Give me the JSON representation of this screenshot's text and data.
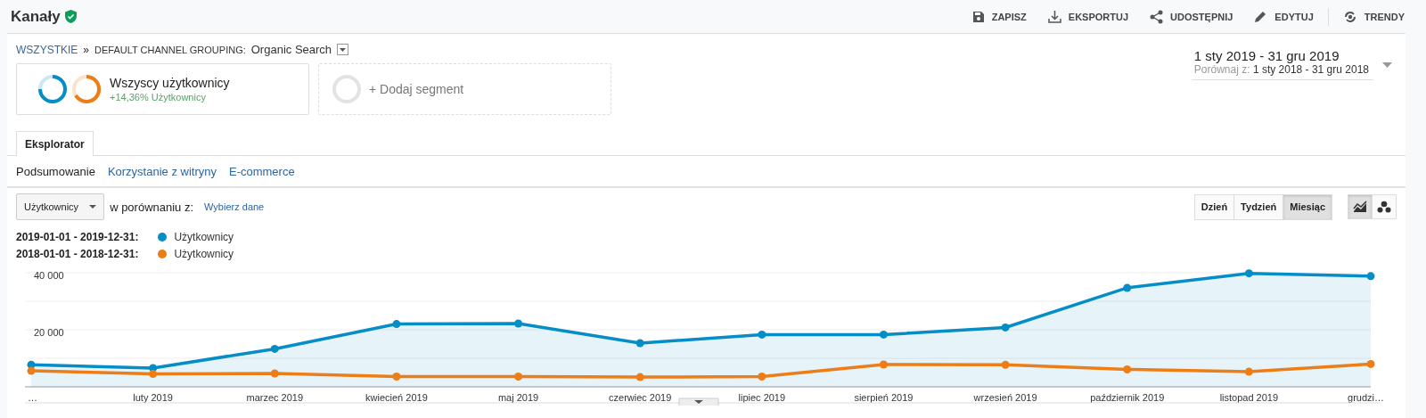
{
  "header": {
    "title": "Kanały",
    "verified": true,
    "actions": [
      {
        "label": "ZAPISZ"
      },
      {
        "label": "EKSPORTUJ"
      },
      {
        "label": "UDOSTĘPNIJ"
      },
      {
        "label": "EDYTUJ"
      },
      {
        "label": "TRENDY"
      }
    ]
  },
  "breadcrumb": {
    "root": "WSZYSTKIE",
    "separator": "»",
    "grouping": "DEFAULT CHANNEL GROUPING:",
    "value": "Organic Search"
  },
  "segments": [
    {
      "kind": "segment",
      "name": "Wszyscy użytkownicy",
      "change": "+14,36% Użytkownicy"
    },
    {
      "kind": "add",
      "name": "+ Dodaj segment"
    }
  ],
  "date_range": {
    "range": "1 sty 2019 - 31 gru 2019",
    "compare_label": "Porównaj z:",
    "compare_range": "1 sty 2018 - 31 gru 2018"
  },
  "tabs": [
    {
      "label": "Eksplorator",
      "selected": true
    }
  ],
  "subtabs": [
    {
      "label": "Podsumowanie",
      "selected": true
    },
    {
      "label": "Korzystanie z witryny",
      "selected": false
    },
    {
      "label": "E-commerce",
      "selected": false
    }
  ],
  "metric": {
    "value": "Użytkownicy",
    "compare_label": "w porównaniu z:",
    "compare_link": "Wybierz dane"
  },
  "granularity": [
    {
      "label": "Dzień",
      "selected": false
    },
    {
      "label": "Tydzień",
      "selected": false
    },
    {
      "label": "Miesiąc",
      "selected": true
    }
  ],
  "chart_modes": [
    {
      "kind": "line",
      "selected": true
    },
    {
      "kind": "motion",
      "selected": false
    }
  ],
  "legend": [
    {
      "metric": "Użytkownicy"
    },
    {
      "metric": "Użytkownicy"
    }
  ],
  "chart": {
    "chart_data": {
      "type": "line",
      "categories": [
        "…",
        "luty 2019",
        "marzec 2019",
        "kwiecień 2019",
        "maj 2019",
        "czerwiec 2019",
        "lipiec 2019",
        "sierpień 2019",
        "wrzesień 2019",
        "październik 2019",
        "listopad 2019",
        "grudzi…"
      ],
      "series": [
        {
          "name": "2019-01-01 - 2019-12-31:",
          "type": "area",
          "marker": "circle",
          "color": "#058dc7",
          "values": [
            7700,
            6600,
            13300,
            22000,
            22200,
            15300,
            18300,
            18300,
            20800,
            34700,
            39800,
            38800
          ]
        },
        {
          "name": "2018-01-01 - 2018-12-31:",
          "type": "line",
          "marker": "circle",
          "color": "#ed7e17",
          "values": [
            5600,
            4500,
            4700,
            3600,
            3600,
            3400,
            3600,
            7800,
            7700,
            6100,
            5300,
            8000
          ]
        }
      ],
      "ylim": [
        0,
        40000
      ],
      "yticks": [
        {
          "value": 20000,
          "label": "20 000"
        },
        {
          "value": 40000,
          "label": "40 000"
        }
      ]
    }
  }
}
